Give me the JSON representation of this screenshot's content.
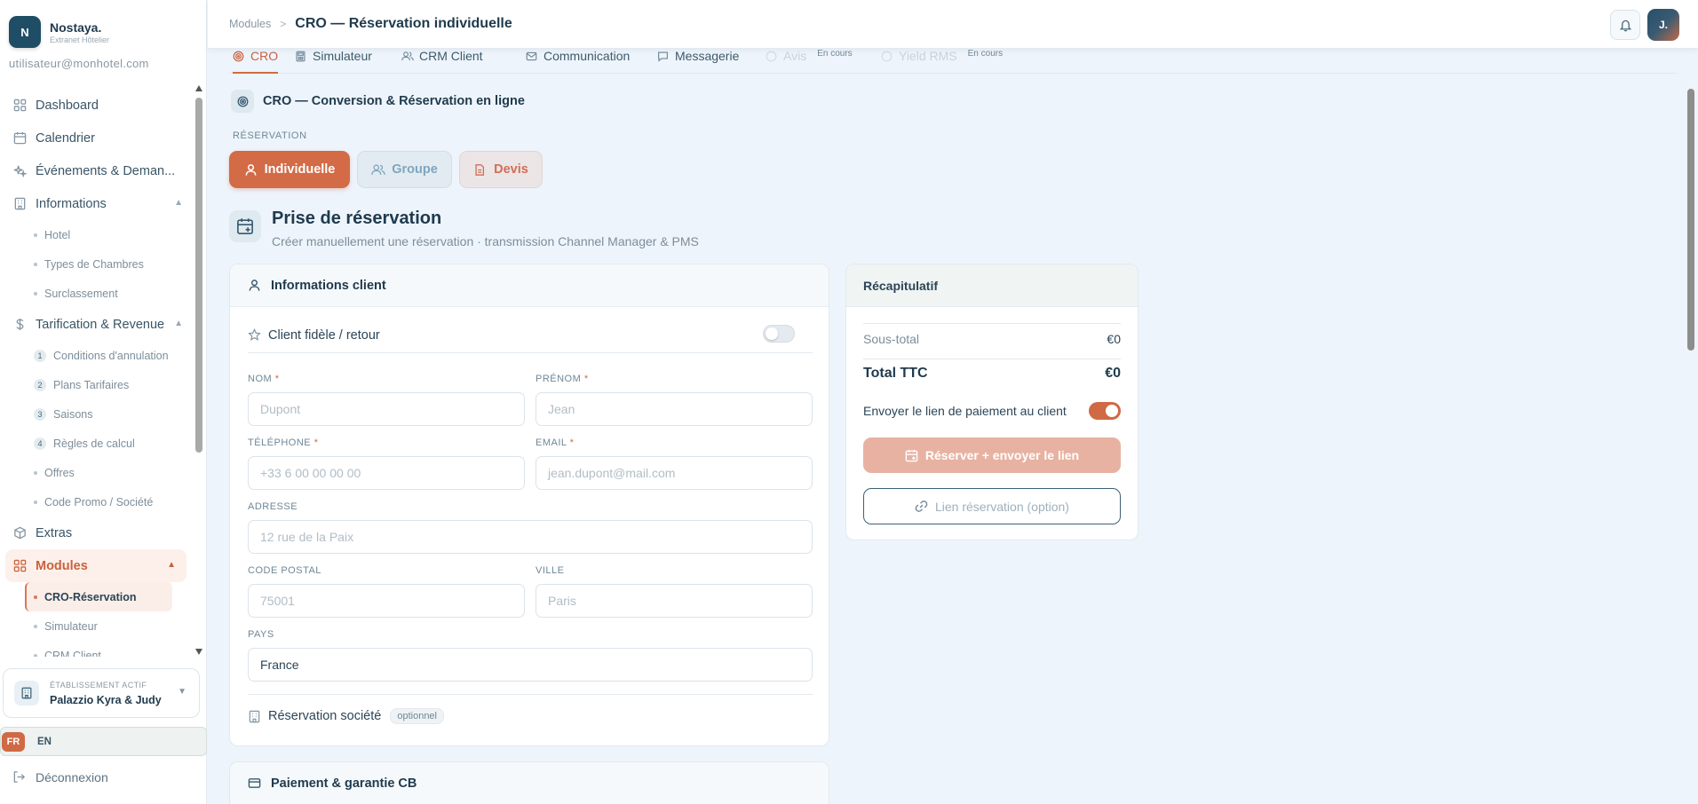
{
  "brand": {
    "logo_letter": "N",
    "name": "Nostaya.",
    "subtitle": "Extranet Hôtelier"
  },
  "user": {
    "email": "utilisateur@monhotel.com",
    "avatar_initial": "J."
  },
  "sidebar": {
    "items": [
      {
        "label": "Dashboard",
        "icon": "dashboard-icon"
      },
      {
        "label": "Calendrier",
        "icon": "calendar-icon"
      },
      {
        "label": "Événements & Deman...",
        "icon": "sparkle-icon"
      },
      {
        "label": "Informations",
        "icon": "building-icon",
        "expanded": true,
        "children": [
          "Hotel",
          "Types de Chambres",
          "Surclassement"
        ]
      },
      {
        "label": "Tarification & Revenue",
        "icon": "dollar-icon",
        "expanded": true,
        "children": [
          {
            "num": "1",
            "label": "Conditions d'annulation"
          },
          {
            "num": "2",
            "label": "Plans Tarifaires"
          },
          {
            "num": "3",
            "label": "Saisons"
          },
          {
            "num": "4",
            "label": "Règles de calcul"
          },
          {
            "label": "Offres"
          },
          {
            "label": "Code Promo / Société"
          }
        ]
      },
      {
        "label": "Extras",
        "icon": "box-icon"
      },
      {
        "label": "Modules",
        "icon": "grid-icon",
        "active": true,
        "expanded": true,
        "children": [
          "CRO-Réservation",
          "Simulateur",
          "CRM Client"
        ]
      }
    ]
  },
  "establishment": {
    "label": "ÉTABLISSEMENT ACTIF",
    "name": "Palazzio Kyra & Judy"
  },
  "languages": {
    "active": "FR",
    "other": "EN"
  },
  "logout_label": "Déconnexion",
  "breadcrumb": {
    "parent": "Modules",
    "separator": ">",
    "current": "CRO — Réservation individuelle"
  },
  "tabs": [
    {
      "label": "CRO",
      "state": "active"
    },
    {
      "label": "Simulateur",
      "state": "normal"
    },
    {
      "label": "CRM Client",
      "state": "normal"
    },
    {
      "label": "Communication",
      "state": "normal"
    },
    {
      "label": "Messagerie",
      "state": "normal"
    },
    {
      "label": "Avis",
      "state": "disabled",
      "badge": "En cours"
    },
    {
      "label": "Yield RMS",
      "state": "disabled",
      "badge": "En cours"
    }
  ],
  "section": {
    "title": "CRO — Conversion & Réservation en ligne"
  },
  "reservation": {
    "label": "RÉSERVATION",
    "buttons": {
      "individuelle": "Individuelle",
      "groupe": "Groupe",
      "devis": "Devis"
    }
  },
  "page": {
    "title": "Prise de réservation",
    "subtitle": "Créer manuellement une réservation · transmission Channel Manager & PMS"
  },
  "client_card": {
    "title": "Informations client",
    "fidele_label": "Client fidèle / retour",
    "fidele_on": false,
    "fields": {
      "nom": {
        "label": "NOM",
        "required": "*",
        "placeholder": "Dupont"
      },
      "prenom": {
        "label": "PRÉNOM",
        "required": "*",
        "placeholder": "Jean"
      },
      "telephone": {
        "label": "TÉLÉPHONE",
        "required": "*",
        "placeholder": "+33 6 00 00 00 00"
      },
      "email": {
        "label": "EMAIL",
        "required": "*",
        "placeholder": "jean.dupont@mail.com"
      },
      "adresse": {
        "label": "ADRESSE",
        "placeholder": "12 rue de la Paix"
      },
      "code_postal": {
        "label": "CODE POSTAL",
        "placeholder": "75001"
      },
      "ville": {
        "label": "VILLE",
        "placeholder": "Paris"
      },
      "pays": {
        "label": "PAYS",
        "value": "France"
      }
    },
    "societe_label": "Réservation société",
    "societe_badge": "optionnel"
  },
  "payment_card": {
    "title": "Paiement & garantie CB"
  },
  "summary": {
    "title": "Récapitulatif",
    "subtotal_label": "Sous-total",
    "subtotal_value": "€0",
    "ttc_label": "Total TTC",
    "ttc_value": "€0",
    "send_link_label": "Envoyer le lien de paiement au client",
    "send_link_on": true,
    "reserve_button": "Réserver + envoyer le lien",
    "link_button": "Lien réservation (option)"
  },
  "colors": {
    "accent": "#d06a44",
    "primary": "#1f4d66",
    "background": "#eef4fb"
  }
}
